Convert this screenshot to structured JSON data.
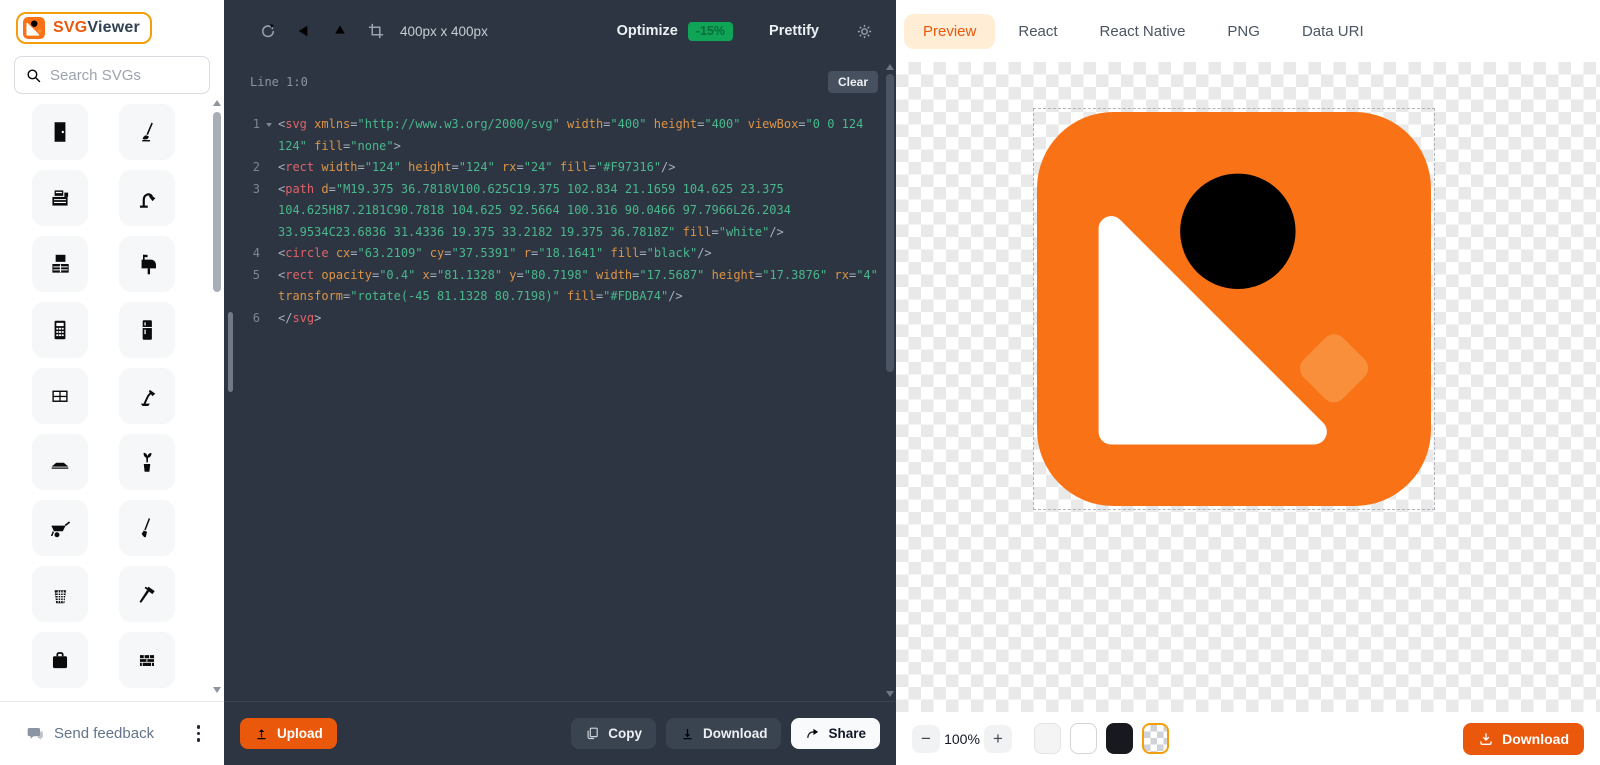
{
  "app": {
    "accent": "#f97316"
  },
  "sidebar": {
    "logo": {
      "brand_orange": "SVG",
      "brand_dark": "Viewer"
    },
    "search": {
      "placeholder": "Search SVGs"
    },
    "icons": [
      "door",
      "mop",
      "cash-register",
      "gooseneck-lamp",
      "tv-stand",
      "mailbox",
      "calculator",
      "refrigerator",
      "window",
      "desk-lamp",
      "tray",
      "plant",
      "wheelbarrow",
      "garden-tool",
      "basket",
      "hammer",
      "briefcase",
      "brick-wall"
    ],
    "feedback_label": "Send feedback"
  },
  "editor": {
    "toolbar": {
      "size_label": "400px x 400px",
      "optimize_label": "Optimize",
      "optimize_badge": "-15%",
      "prettify_label": "Prettify"
    },
    "status": {
      "line_label": "Line 1:0",
      "clear_label": "Clear"
    },
    "code": {
      "rows": [
        {
          "n": "1",
          "fold": true,
          "segs": [
            [
              "<",
              "p"
            ],
            [
              "svg",
              "t"
            ],
            [
              " ",
              "s"
            ],
            [
              "xmlns",
              "a"
            ],
            [
              "=",
              "p"
            ],
            [
              "\"http://www.w3.org/2000/svg\"",
              "v"
            ],
            [
              " ",
              "s"
            ],
            [
              "width",
              "a"
            ],
            [
              "=",
              "p"
            ],
            [
              "\"400\"",
              "v"
            ],
            [
              " ",
              "s"
            ],
            [
              "height",
              "a"
            ],
            [
              "=",
              "p"
            ],
            [
              "\"400\"",
              "v"
            ],
            [
              " ",
              "s"
            ],
            [
              "viewBox",
              "a"
            ],
            [
              "=",
              "p"
            ],
            [
              "\"0 0 124",
              "v"
            ]
          ]
        },
        {
          "n": "",
          "segs": [
            [
              "124\"",
              "v"
            ],
            [
              " ",
              "s"
            ],
            [
              "fill",
              "a"
            ],
            [
              "=",
              "p"
            ],
            [
              "\"none\"",
              "v"
            ],
            [
              ">",
              "p"
            ]
          ]
        },
        {
          "n": "2",
          "segs": [
            [
              "<",
              "p"
            ],
            [
              "rect",
              "t"
            ],
            [
              " ",
              "s"
            ],
            [
              "width",
              "a"
            ],
            [
              "=",
              "p"
            ],
            [
              "\"124\"",
              "v"
            ],
            [
              " ",
              "s"
            ],
            [
              "height",
              "a"
            ],
            [
              "=",
              "p"
            ],
            [
              "\"124\"",
              "v"
            ],
            [
              " ",
              "s"
            ],
            [
              "rx",
              "a"
            ],
            [
              "=",
              "p"
            ],
            [
              "\"24\"",
              "v"
            ],
            [
              " ",
              "s"
            ],
            [
              "fill",
              "a"
            ],
            [
              "=",
              "p"
            ],
            [
              "\"#F97316\"",
              "v"
            ],
            [
              "/>",
              "p"
            ]
          ]
        },
        {
          "n": "3",
          "segs": [
            [
              "<",
              "p"
            ],
            [
              "path",
              "t"
            ],
            [
              " ",
              "s"
            ],
            [
              "d",
              "a"
            ],
            [
              "=",
              "p"
            ],
            [
              "\"M19.375 36.7818V100.625C19.375 102.834 21.1659 104.625 23.375",
              "v"
            ]
          ]
        },
        {
          "n": "",
          "segs": [
            [
              "104.625H87.2181C90.7818 104.625 92.5664 100.316 90.0466 97.7966L26.2034",
              "v"
            ]
          ]
        },
        {
          "n": "",
          "segs": [
            [
              "33.9534C23.6836 31.4336 19.375 33.2182 19.375 36.7818Z\"",
              "v"
            ],
            [
              " ",
              "s"
            ],
            [
              "fill",
              "a"
            ],
            [
              "=",
              "p"
            ],
            [
              "\"white\"",
              "v"
            ],
            [
              "/>",
              "p"
            ]
          ]
        },
        {
          "n": "4",
          "segs": [
            [
              "<",
              "p"
            ],
            [
              "circle",
              "t"
            ],
            [
              " ",
              "s"
            ],
            [
              "cx",
              "a"
            ],
            [
              "=",
              "p"
            ],
            [
              "\"63.2109\"",
              "v"
            ],
            [
              " ",
              "s"
            ],
            [
              "cy",
              "a"
            ],
            [
              "=",
              "p"
            ],
            [
              "\"37.5391\"",
              "v"
            ],
            [
              " ",
              "s"
            ],
            [
              "r",
              "a"
            ],
            [
              "=",
              "p"
            ],
            [
              "\"18.1641\"",
              "v"
            ],
            [
              " ",
              "s"
            ],
            [
              "fill",
              "a"
            ],
            [
              "=",
              "p"
            ],
            [
              "\"black\"",
              "v"
            ],
            [
              "/>",
              "p"
            ]
          ]
        },
        {
          "n": "5",
          "segs": [
            [
              "<",
              "p"
            ],
            [
              "rect",
              "t"
            ],
            [
              " ",
              "s"
            ],
            [
              "opacity",
              "a"
            ],
            [
              "=",
              "p"
            ],
            [
              "\"0.4\"",
              "v"
            ],
            [
              " ",
              "s"
            ],
            [
              "x",
              "a"
            ],
            [
              "=",
              "p"
            ],
            [
              "\"81.1328\"",
              "v"
            ],
            [
              " ",
              "s"
            ],
            [
              "y",
              "a"
            ],
            [
              "=",
              "p"
            ],
            [
              "\"80.7198\"",
              "v"
            ],
            [
              " ",
              "s"
            ],
            [
              "width",
              "a"
            ],
            [
              "=",
              "p"
            ],
            [
              "\"17.5687\"",
              "v"
            ],
            [
              " ",
              "s"
            ],
            [
              "height",
              "a"
            ],
            [
              "=",
              "p"
            ],
            [
              "\"17.3876\"",
              "v"
            ],
            [
              " ",
              "s"
            ],
            [
              "rx",
              "a"
            ],
            [
              "=",
              "p"
            ],
            [
              "\"4\"",
              "v"
            ]
          ]
        },
        {
          "n": "",
          "segs": [
            [
              "transform",
              "a"
            ],
            [
              "=",
              "p"
            ],
            [
              "\"rotate(-45 81.1328 80.7198)\"",
              "v"
            ],
            [
              " ",
              "s"
            ],
            [
              "fill",
              "a"
            ],
            [
              "=",
              "p"
            ],
            [
              "\"#FDBA74\"",
              "v"
            ],
            [
              "/>",
              "p"
            ]
          ]
        },
        {
          "n": "6",
          "segs": [
            [
              "</",
              "p"
            ],
            [
              "svg",
              "t"
            ],
            [
              ">",
              "p"
            ]
          ]
        }
      ]
    },
    "footer": {
      "upload_label": "Upload",
      "copy_label": "Copy",
      "download_label": "Download",
      "share_label": "Share"
    }
  },
  "preview": {
    "tabs": [
      "Preview",
      "React",
      "React Native",
      "PNG",
      "Data URI"
    ],
    "active_tab": "Preview",
    "zoom_level": "100%",
    "background_options": [
      "light",
      "white",
      "dark",
      "transparent"
    ],
    "selected_background": "transparent",
    "download_label": "Download",
    "svg_markup": "<svg xmlns=\"http://www.w3.org/2000/svg\" width=\"400\" height=\"400\" viewBox=\"0 0 124 124\" fill=\"none\"><rect width=\"124\" height=\"124\" rx=\"24\" fill=\"#F97316\"/><path d=\"M19.375 36.7818V100.625C19.375 102.834 21.1659 104.625 23.375 104.625H87.2181C90.7818 104.625 92.5664 100.316 90.0466 97.7966L26.2034 33.9534C23.6836 31.4336 19.375 33.2182 19.375 36.7818Z\" fill=\"white\"/><circle cx=\"63.2109\" cy=\"37.5391\" r=\"18.1641\" fill=\"black\"/><rect opacity=\"0.4\" x=\"81.1328\" y=\"80.7198\" width=\"17.5687\" height=\"17.3876\" rx=\"4\" transform=\"rotate(-45 81.1328 80.7198)\" fill=\"#FDBA74\"/></svg>"
  }
}
